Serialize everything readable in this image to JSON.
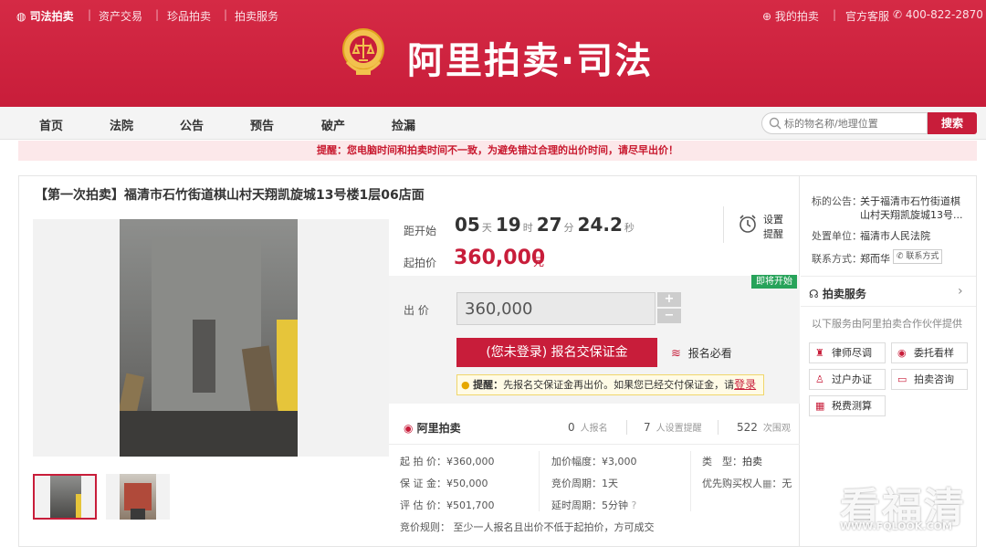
{
  "topbar": {
    "brand": "司法拍卖",
    "links": [
      "资产交易",
      "珍品拍卖",
      "拍卖服务"
    ],
    "my_auction": "我的拍卖",
    "customer_service": "官方客服",
    "phone": "400-822-2870"
  },
  "header": {
    "title": "阿里拍卖·司法"
  },
  "nav": {
    "items": [
      "首页",
      "法院",
      "公告",
      "预告",
      "破产",
      "捡漏"
    ]
  },
  "search": {
    "placeholder": "标的物名称/地理位置",
    "button": "搜索"
  },
  "notice": "提醒：您电脑时间和拍卖时间不一致，为避免错过合理的出价时间，请尽早出价！",
  "item": {
    "title": "【第一次拍卖】福清市石竹街道棋山村天翔凯旋城13号楼1层06店面",
    "countdown_label": "距开始",
    "countdown": {
      "days": "05",
      "days_unit": "天",
      "hours": "19",
      "hours_unit": "时",
      "minutes": "27",
      "minutes_unit": "分",
      "seconds": "24.2",
      "seconds_unit": "秒"
    },
    "start_price_label": "起拍价",
    "start_price": "360,000",
    "start_price_unit": "元",
    "reminder_label_1": "设置",
    "reminder_label_2": "提醒",
    "upcoming_badge": "即将开始",
    "bid_label": "出 价",
    "bid_value": "360,000",
    "register_button": "(您未登录) 报名交保证金",
    "must_read": "报名必看",
    "tip_prefix": "提醒：",
    "tip_text": "先报名交保证金再出价。如果您已经交付保证金，请",
    "tip_login": "登录"
  },
  "stats": {
    "logo_text": "阿里拍卖",
    "registrants": "0",
    "registrants_label": "人报名",
    "reminders": "7",
    "reminders_label": "人设置提醒",
    "views": "522",
    "views_label": "次围观"
  },
  "details": {
    "start_price": "起 拍 价：¥360,000",
    "deposit": "保 证 金：¥50,000",
    "appraisal": "评 估 价：¥501,700",
    "increment": "加价幅度：¥3,000",
    "cycle": "竞价周期：1天",
    "delay": "延时周期：5分钟",
    "type_label": "类　型：",
    "type_value": "拍卖",
    "priority": "优先购买权人",
    "priority_value": "：无",
    "rule": "竞价规则：  至少一人报名且出价不低于起拍价，方可成交"
  },
  "sidebar": {
    "announce_label": "标的公告：",
    "announce_value_1": "关于福清市石竹街道棋",
    "announce_value_2": "山村天翔凯旋城13号...",
    "court_label": "处置单位：",
    "court_value": "福清市人民法院",
    "contact_label": "联系方式：",
    "contact_name": "郑而华",
    "contact_button": "联系方式",
    "service_title": "拍卖服务",
    "service_desc": "以下服务由阿里拍卖合作伙伴提供",
    "services": [
      "律师尽调",
      "委托看样",
      "过户办证",
      "拍卖咨询",
      "税费测算"
    ]
  },
  "watermark": {
    "main": "看福清",
    "sub": "WWW.FQLOOK.COM"
  },
  "colors": {
    "brand_red": "#c81d3a",
    "green": "#27a35a"
  }
}
